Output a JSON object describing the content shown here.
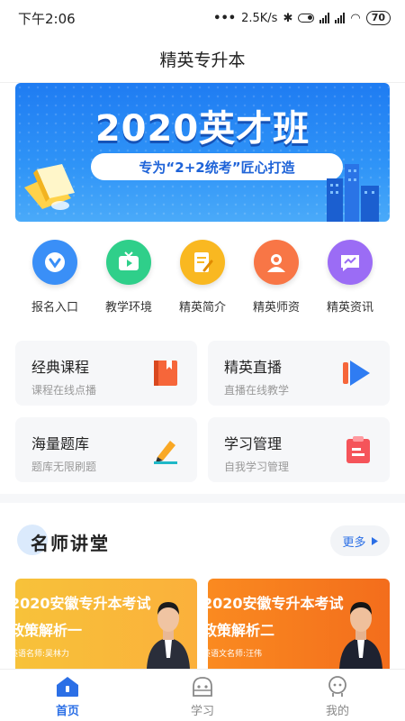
{
  "status_bar": {
    "time": "下午2:06",
    "network_speed": "2.5K/s",
    "battery": "70"
  },
  "header": {
    "title": "精英专升本"
  },
  "banner": {
    "title": "2020英才班",
    "subtitle": "专为“2+2统考”匠心打造"
  },
  "quick_entries": [
    {
      "label": "报名入口",
      "icon": "signup-icon",
      "color": "#3a8ff7"
    },
    {
      "label": "教学环境",
      "icon": "tv-icon",
      "color": "#2fcf8a"
    },
    {
      "label": "精英简介",
      "icon": "document-edit-icon",
      "color": "#f9b821"
    },
    {
      "label": "精英师资",
      "icon": "teacher-icon",
      "color": "#f87646"
    },
    {
      "label": "精英资讯",
      "icon": "news-icon",
      "color": "#9b6cf5"
    }
  ],
  "feature_cards": [
    {
      "title": "经典课程",
      "subtitle": "课程在线点播",
      "icon": "book-icon"
    },
    {
      "title": "精英直播",
      "subtitle": "直播在线教学",
      "icon": "live-play-icon"
    },
    {
      "title": "海量题库",
      "subtitle": "题库无限刷题",
      "icon": "pencil-icon"
    },
    {
      "title": "学习管理",
      "subtitle": "自我学习管理",
      "icon": "clipboard-icon"
    }
  ],
  "section": {
    "title": "名师讲堂",
    "more_label": "更多"
  },
  "teacher_cards": [
    {
      "line1": "2020安徽专升本考试",
      "line2": "政策解析一",
      "teacher": "英语名师:吴林力"
    },
    {
      "line1": "2020安徽专升本考试",
      "line2": "政策解析二",
      "teacher": "英语文名师:汪伟"
    }
  ],
  "tab_bar": [
    {
      "label": "首页",
      "icon": "home-icon",
      "active": true
    },
    {
      "label": "学习",
      "icon": "study-icon",
      "active": false
    },
    {
      "label": "我的",
      "icon": "profile-icon",
      "active": false
    }
  ],
  "colors": {
    "accent": "#2b6fe6",
    "banner_blue": "#1f7cf2"
  }
}
